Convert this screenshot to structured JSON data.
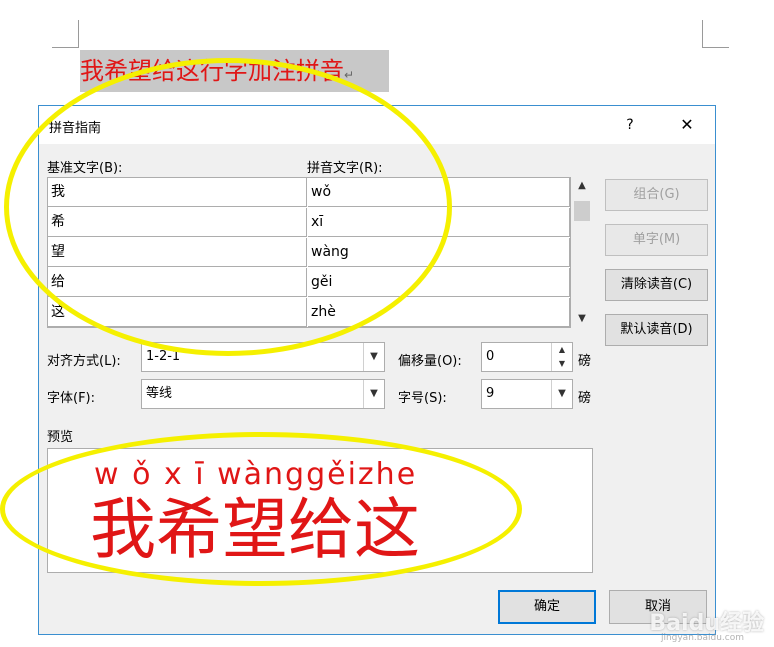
{
  "document": {
    "selected_text": "我希望给这行字加注拼音"
  },
  "dialog": {
    "title": "拼音指南",
    "help": "?",
    "close": "✕",
    "base_text_label": "基准文字(B):",
    "ruby_text_label": "拼音文字(R):",
    "rows": [
      {
        "base": "我",
        "ruby": "wǒ"
      },
      {
        "base": "希",
        "ruby": "xī"
      },
      {
        "base": "望",
        "ruby": "wàng"
      },
      {
        "base": "给",
        "ruby": "gěi"
      },
      {
        "base": "这",
        "ruby": "zhè"
      }
    ],
    "buttons": {
      "group": "组合(G)",
      "mono": "单字(M)",
      "clear": "清除读音(C)",
      "default_reading": "默认读音(D)",
      "ok": "确定",
      "cancel": "取消"
    },
    "alignment": {
      "label": "对齐方式(L):",
      "value": "1-2-1"
    },
    "offset": {
      "label": "偏移量(O):",
      "value": "0",
      "unit": "磅"
    },
    "font": {
      "label": "字体(F):",
      "value": "等线"
    },
    "size": {
      "label": "字号(S):",
      "value": "9",
      "unit": "磅"
    },
    "preview": {
      "label": "预览",
      "pinyin": "w ǒ x ī wànggěizhe",
      "text": "我希望给这"
    }
  },
  "watermark": {
    "brand": "Baidu经验",
    "url": "jingyan.baidu.com"
  },
  "colors": {
    "text_red": "#e01616",
    "highlight_yellow": "#f5f000",
    "dialog_border": "#3a8fd0"
  }
}
